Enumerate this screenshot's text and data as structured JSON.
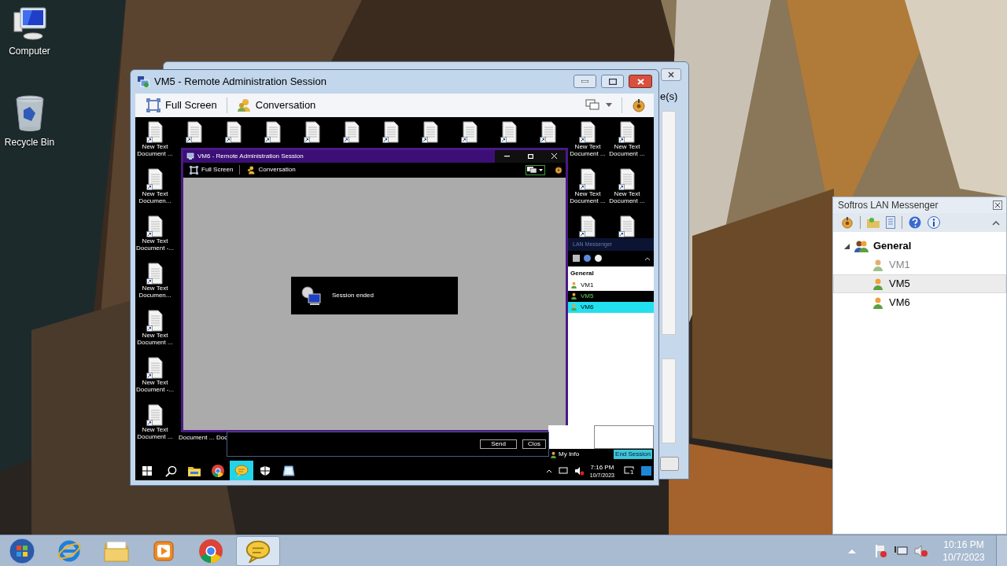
{
  "desktop_icons": [
    {
      "kind": "computer",
      "label": "Computer"
    },
    {
      "kind": "recycle_bin",
      "label": "Recycle Bin"
    }
  ],
  "background_window": {
    "partial_text": "e(s)"
  },
  "session_window": {
    "title": "VM5 - Remote Administration Session",
    "toolbar": [
      {
        "kind": "full_screen",
        "label": "Full Screen"
      },
      {
        "kind": "conversation",
        "label": "Conversation"
      }
    ],
    "remote_desktop": {
      "icon_columns": [
        [
          {
            "label": "New Text Document ..."
          },
          {
            "label": "New Text Documen..."
          },
          {
            "label": "New Text Document -..."
          },
          {
            "label": "New Text Documen..."
          },
          {
            "label": "New Text Document ..."
          },
          {
            "label": "New Text Document -..."
          },
          {
            "label": "New Text Document ..."
          }
        ],
        [
          {}
        ],
        [
          {}
        ],
        [
          {}
        ],
        [
          {}
        ],
        [
          {}
        ],
        [
          {}
        ],
        [
          {}
        ],
        [
          {}
        ],
        [
          {}
        ],
        [
          {}
        ],
        [
          {
            "label": "New Text Document ..."
          },
          {
            "label": "New Text Document ..."
          },
          {}
        ],
        [
          {
            "label": "New Text Document ..."
          },
          {
            "label": "New Text Document ..."
          },
          {}
        ]
      ],
      "partial_labels": [
        "Document ...",
        "Doc"
      ],
      "inner_session_window": {
        "title": "VM6 - Remote Administration Session",
        "toolbar": [
          {
            "kind": "full_screen",
            "label": "Full Screen"
          },
          {
            "kind": "conversation",
            "label": "Conversation"
          }
        ],
        "notice": "Session ended"
      },
      "messenger": {
        "title": "LAN Messenger",
        "group": "General",
        "contacts": [
          {
            "name": "VM1",
            "selected": false,
            "hovered": false
          },
          {
            "name": "VM5",
            "selected": true,
            "hovered": false
          },
          {
            "name": "VM6",
            "selected": false,
            "hovered": true
          }
        ],
        "my_info": "My Info",
        "end_session": "End Session"
      },
      "conversation": {
        "buttons": [
          "Send",
          "Clos"
        ]
      },
      "taskbar": {
        "apps": [
          {
            "kind": "start",
            "active": false
          },
          {
            "kind": "search",
            "active": false
          },
          {
            "kind": "explorer",
            "active": false
          },
          {
            "kind": "browser",
            "active": false
          },
          {
            "kind": "messenger",
            "active": true
          },
          {
            "kind": "shield",
            "active": false
          },
          {
            "kind": "app",
            "active": false
          }
        ],
        "time": "7:16 PM",
        "date": "10/7/2023",
        "notifications": "1"
      }
    }
  },
  "messenger_window": {
    "title": "Softros LAN Messenger",
    "group": "General",
    "expanded": true,
    "contacts": [
      {
        "name": "VM1",
        "online": false,
        "selected": false
      },
      {
        "name": "VM5",
        "online": true,
        "selected": true
      },
      {
        "name": "VM6",
        "online": true,
        "selected": false
      }
    ]
  },
  "taskbar": {
    "apps": [
      {
        "kind": "ie",
        "active": false
      },
      {
        "kind": "explorer",
        "active": false
      },
      {
        "kind": "media_player",
        "active": false
      },
      {
        "kind": "browser",
        "active": false
      },
      {
        "kind": "messenger",
        "active": true
      }
    ],
    "time": "10:16 PM",
    "date": "10/7/2023"
  }
}
